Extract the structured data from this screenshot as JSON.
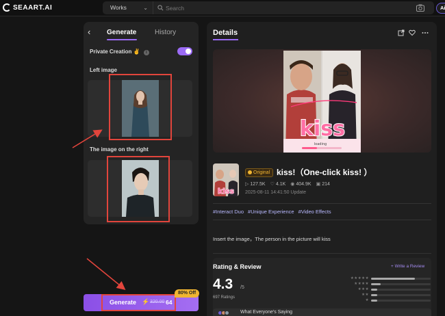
{
  "app": {
    "brand": "SEAART.AI"
  },
  "topbar": {
    "works_label": "Works",
    "search_placeholder": "Search",
    "ai_label": "Ai"
  },
  "left_panel": {
    "tab_generate": "Generate",
    "tab_history": "History",
    "private_creation": "Private Creation",
    "left_image_label": "Left image",
    "right_image_label": "The image on the right"
  },
  "generate_bar": {
    "label": "Generate",
    "old_price": "320.00",
    "new_price": "64",
    "badge": "80% Off"
  },
  "details": {
    "title": "Details",
    "original_badge": "Original",
    "work_title": "kiss!（One-click kiss! ）",
    "stats": {
      "views": "127.5K",
      "likes": "4.1K",
      "eye": "404.9K",
      "comments": "214"
    },
    "update_time": "2025-08-11 14:41:50 Update",
    "tags": [
      "#Interact Duo",
      "#Unique Experience",
      "#Video Effects"
    ],
    "description": "Insert the image，The person in the picture will kiss",
    "hero_overlay_text": "kiss",
    "hero_loading": "loading"
  },
  "rating": {
    "title": "Rating & Review",
    "write_label": "+ Write a Review",
    "score": "4.3",
    "out_of": "/5",
    "count": "697 Ratings",
    "distribution": [
      0.74,
      0.16,
      0.1,
      0.1,
      0.1
    ],
    "everyone_saying": "What Everyone's Saying"
  },
  "colors": {
    "accent": "#9b6bf5",
    "annotation": "#e2453c",
    "badge": "#f0b532"
  }
}
